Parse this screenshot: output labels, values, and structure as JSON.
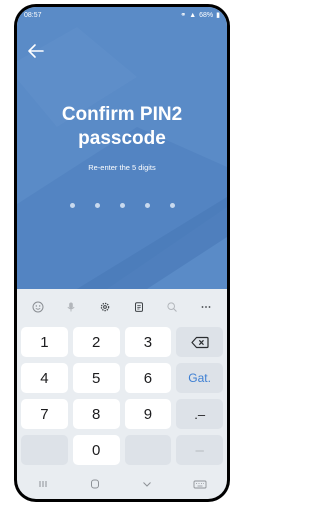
{
  "status": {
    "time": "08:57",
    "battery": "68%"
  },
  "screen": {
    "title_line1": "Confirm PIN2",
    "title_line2": "passcode",
    "subtitle": "Re-enter the 5 digits",
    "pin_length": 5,
    "digits_entered": 0
  },
  "keyboard": {
    "toolbar": [
      "emoji-icon",
      "mic-icon",
      "settings-icon",
      "clipboard-icon",
      "search-icon",
      "more-icon"
    ],
    "keys": {
      "k1": "1",
      "k2": "2",
      "k3": "3",
      "k4": "4",
      "k5": "5",
      "k6": "6",
      "go": "Gat.",
      "k7": "7",
      "k8": "8",
      "k9": "9",
      "punct": ".–",
      "k0": "0",
      "minus": "–"
    }
  },
  "colors": {
    "hero": "#5a8bc7",
    "accent": "#3d7fd3"
  }
}
